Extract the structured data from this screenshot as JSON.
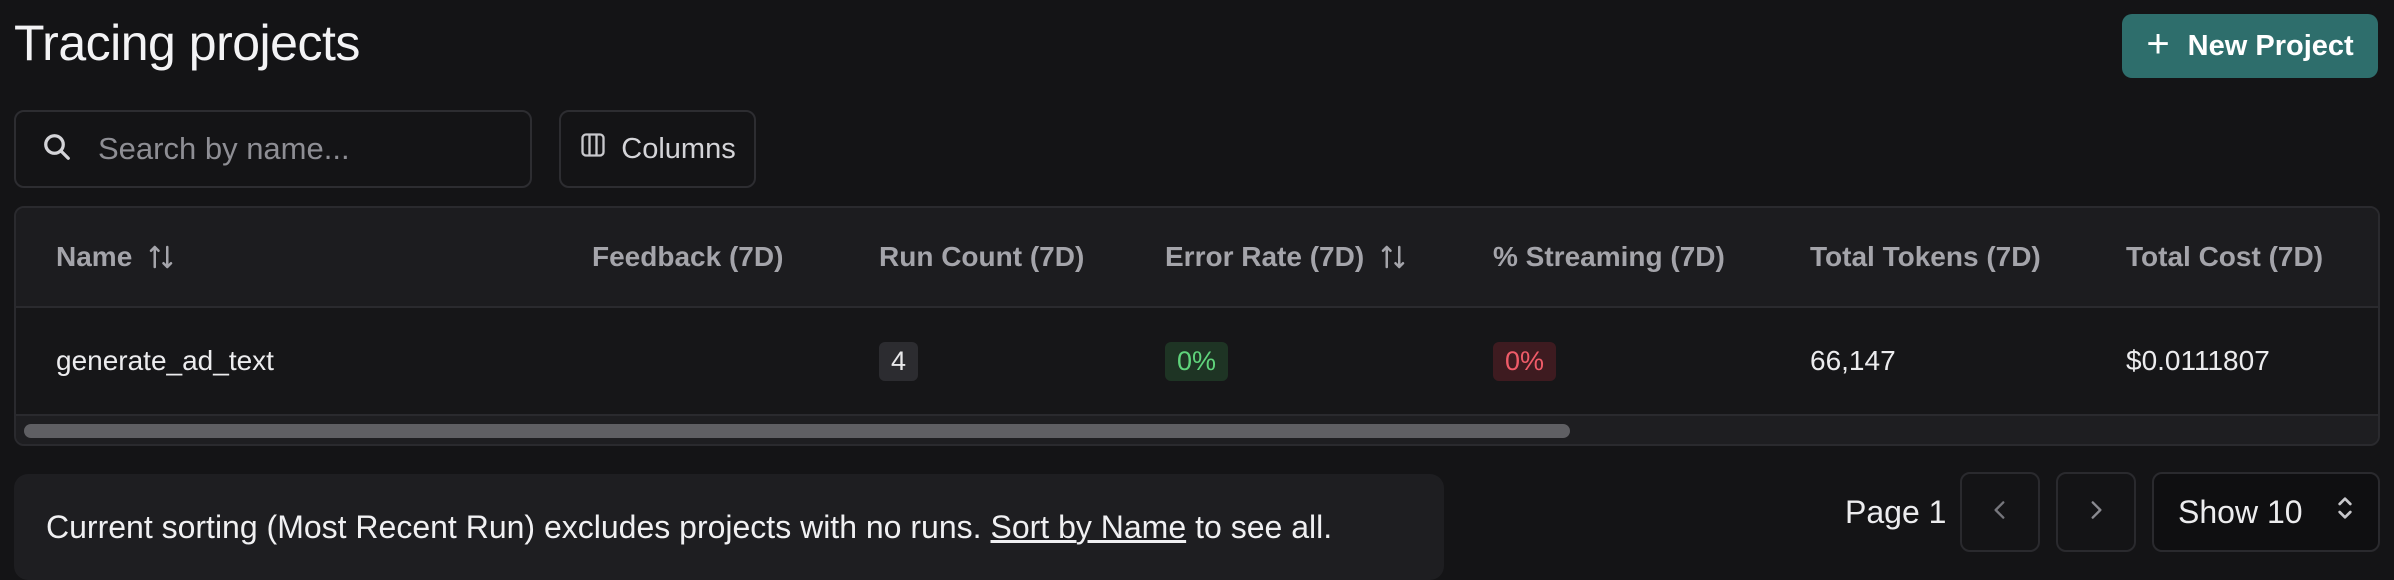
{
  "header": {
    "title": "Tracing projects",
    "new_project_label": "New Project"
  },
  "toolbar": {
    "search_placeholder": "Search by name...",
    "search_value": "",
    "columns_label": "Columns"
  },
  "table": {
    "columns": [
      "Name",
      "Feedback (7D)",
      "Run Count (7D)",
      "Error Rate (7D)",
      "% Streaming (7D)",
      "Total Tokens (7D)",
      "Total Cost (7D)"
    ],
    "rows": [
      {
        "name": "generate_ad_text",
        "feedback": "",
        "run_count": "4",
        "error_rate": "0%",
        "streaming": "0%",
        "total_tokens": "66,147",
        "total_cost": "$0.0111807"
      }
    ]
  },
  "notice": {
    "text_before": "Current sorting (Most Recent Run) excludes projects with no runs.",
    "link": "Sort by Name",
    "text_after": "to see all."
  },
  "pagination": {
    "page_label": "Page 1",
    "show_label": "Show 10"
  },
  "colors": {
    "background": "#141416",
    "primary_button": "#2e6e6c",
    "success_text": "#5fd37b",
    "error_text": "#ef5b68"
  },
  "icons": {
    "new_project": "plus-icon",
    "search": "search-icon",
    "columns": "columns-icon",
    "sort": "sort-arrows-icon",
    "prev": "chevron-left-icon",
    "next": "chevron-right-icon",
    "select": "chevron-updown-icon"
  }
}
